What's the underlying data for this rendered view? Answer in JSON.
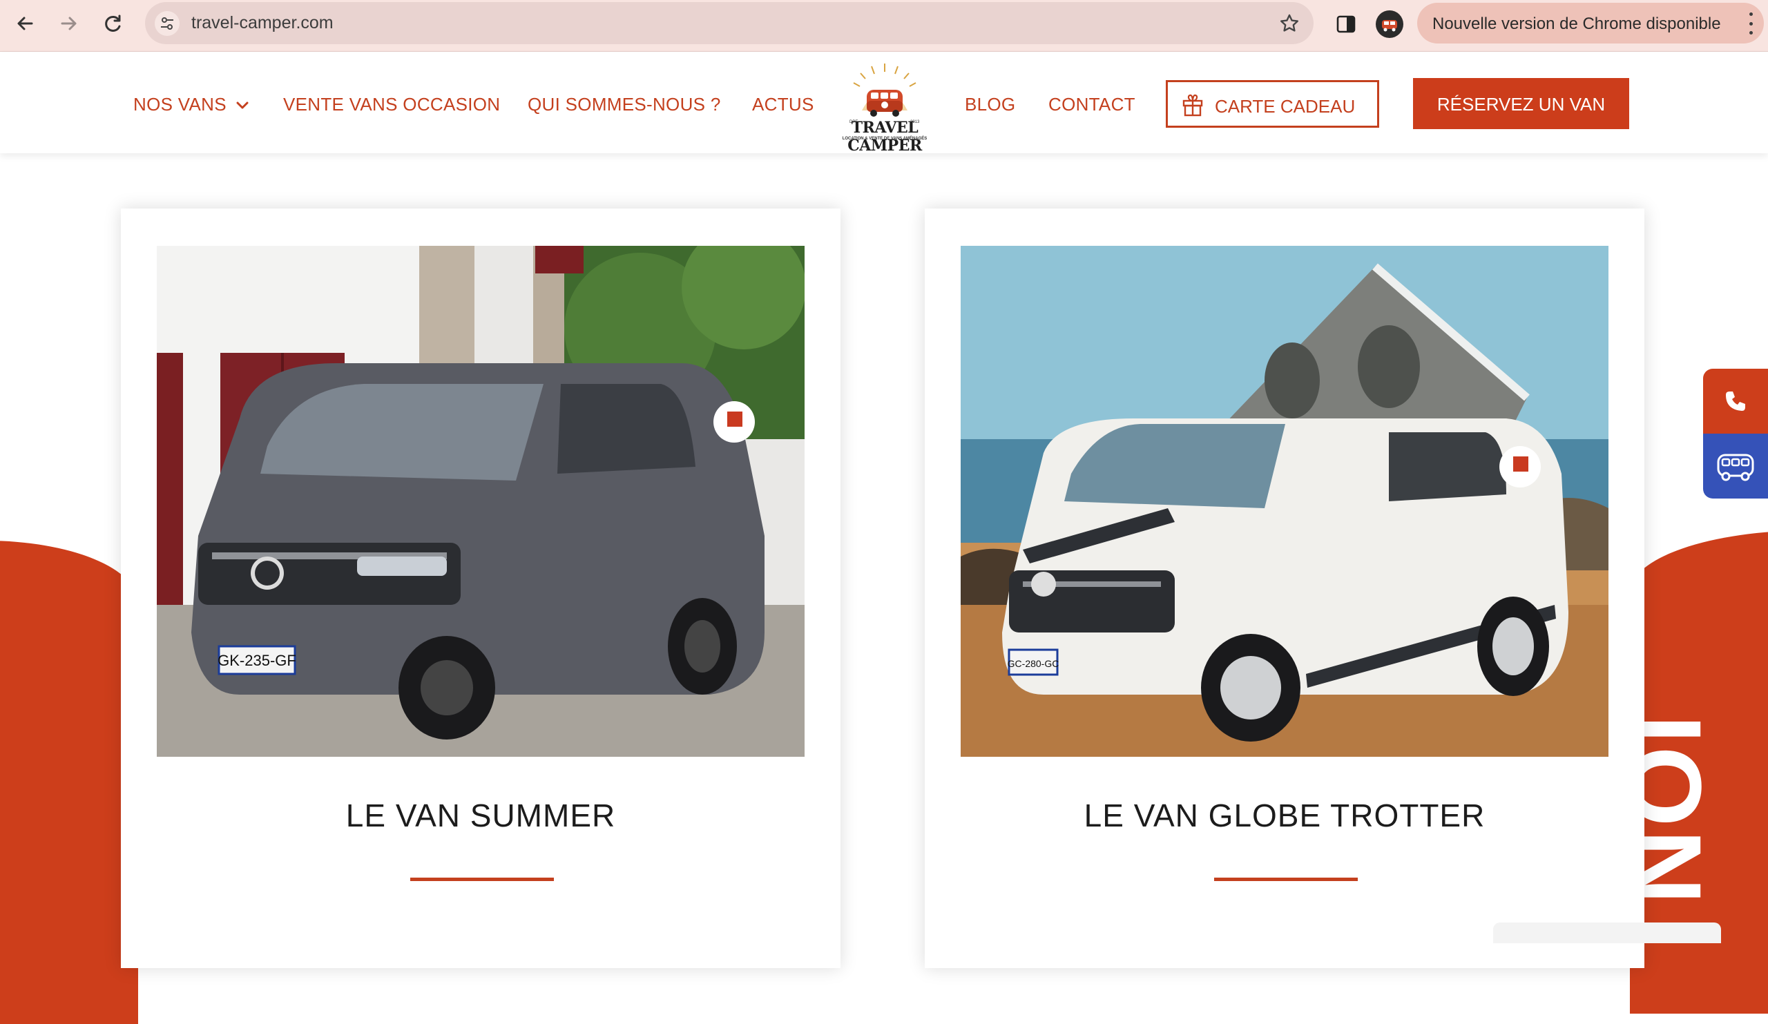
{
  "browser": {
    "url": "travel-camper.com",
    "update_label": "Nouvelle version de Chrome disponible"
  },
  "header": {
    "nav_left": [
      {
        "label": "NOS VANS"
      },
      {
        "label": "VENTE VANS OCCASION"
      },
      {
        "label": "QUI SOMMES-NOUS ?"
      },
      {
        "label": "ACTUS"
      }
    ],
    "logo": {
      "name": "TRAVEL CAMPER",
      "tagline": "LOCATION & VENTE DE VANS AMÉNAGÉS",
      "left_tag": "DPE",
      "right_tag": "2013"
    },
    "nav_right": [
      {
        "label": "BLOG"
      },
      {
        "label": "CONTACT"
      }
    ],
    "gift_label": "CARTE CADEAU",
    "book_label": "RÉSERVEZ UN VAN"
  },
  "cards": [
    {
      "title": "LE VAN SUMMER",
      "plate": "GK-235-GF"
    },
    {
      "title": "LE VAN GLOBE TROTTER",
      "plate": "GC-280-GC"
    }
  ],
  "background_text": "ION",
  "colors": {
    "brand_orange": "#cd3e1b",
    "chrome_tint": "#f8e4e0",
    "widget_blue": "#3552b8"
  },
  "icons": {
    "float_top": "phone-icon",
    "float_bottom": "van-icon"
  }
}
